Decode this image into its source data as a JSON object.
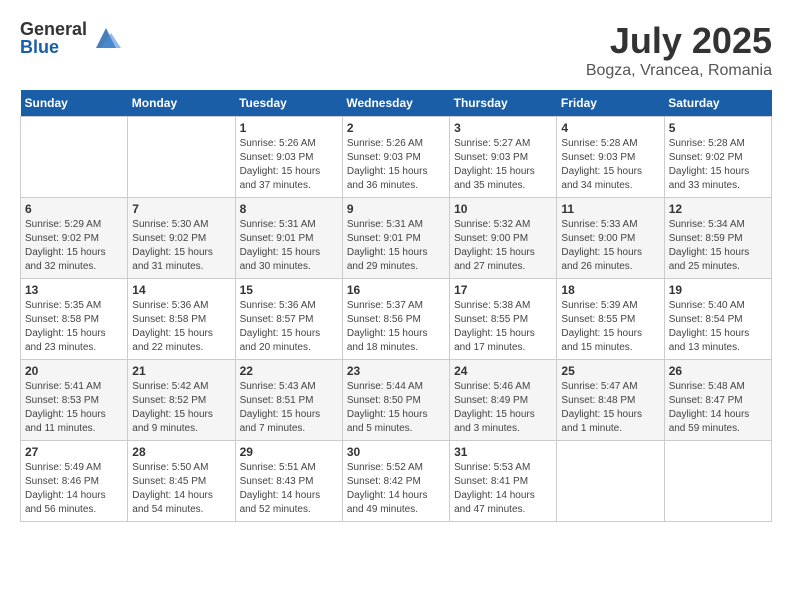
{
  "header": {
    "logo_general": "General",
    "logo_blue": "Blue",
    "month_year": "July 2025",
    "location": "Bogza, Vrancea, Romania"
  },
  "weekdays": [
    "Sunday",
    "Monday",
    "Tuesday",
    "Wednesday",
    "Thursday",
    "Friday",
    "Saturday"
  ],
  "weeks": [
    [
      {
        "day": "",
        "info": ""
      },
      {
        "day": "",
        "info": ""
      },
      {
        "day": "1",
        "info": "Sunrise: 5:26 AM\nSunset: 9:03 PM\nDaylight: 15 hours\nand 37 minutes."
      },
      {
        "day": "2",
        "info": "Sunrise: 5:26 AM\nSunset: 9:03 PM\nDaylight: 15 hours\nand 36 minutes."
      },
      {
        "day": "3",
        "info": "Sunrise: 5:27 AM\nSunset: 9:03 PM\nDaylight: 15 hours\nand 35 minutes."
      },
      {
        "day": "4",
        "info": "Sunrise: 5:28 AM\nSunset: 9:03 PM\nDaylight: 15 hours\nand 34 minutes."
      },
      {
        "day": "5",
        "info": "Sunrise: 5:28 AM\nSunset: 9:02 PM\nDaylight: 15 hours\nand 33 minutes."
      }
    ],
    [
      {
        "day": "6",
        "info": "Sunrise: 5:29 AM\nSunset: 9:02 PM\nDaylight: 15 hours\nand 32 minutes."
      },
      {
        "day": "7",
        "info": "Sunrise: 5:30 AM\nSunset: 9:02 PM\nDaylight: 15 hours\nand 31 minutes."
      },
      {
        "day": "8",
        "info": "Sunrise: 5:31 AM\nSunset: 9:01 PM\nDaylight: 15 hours\nand 30 minutes."
      },
      {
        "day": "9",
        "info": "Sunrise: 5:31 AM\nSunset: 9:01 PM\nDaylight: 15 hours\nand 29 minutes."
      },
      {
        "day": "10",
        "info": "Sunrise: 5:32 AM\nSunset: 9:00 PM\nDaylight: 15 hours\nand 27 minutes."
      },
      {
        "day": "11",
        "info": "Sunrise: 5:33 AM\nSunset: 9:00 PM\nDaylight: 15 hours\nand 26 minutes."
      },
      {
        "day": "12",
        "info": "Sunrise: 5:34 AM\nSunset: 8:59 PM\nDaylight: 15 hours\nand 25 minutes."
      }
    ],
    [
      {
        "day": "13",
        "info": "Sunrise: 5:35 AM\nSunset: 8:58 PM\nDaylight: 15 hours\nand 23 minutes."
      },
      {
        "day": "14",
        "info": "Sunrise: 5:36 AM\nSunset: 8:58 PM\nDaylight: 15 hours\nand 22 minutes."
      },
      {
        "day": "15",
        "info": "Sunrise: 5:36 AM\nSunset: 8:57 PM\nDaylight: 15 hours\nand 20 minutes."
      },
      {
        "day": "16",
        "info": "Sunrise: 5:37 AM\nSunset: 8:56 PM\nDaylight: 15 hours\nand 18 minutes."
      },
      {
        "day": "17",
        "info": "Sunrise: 5:38 AM\nSunset: 8:55 PM\nDaylight: 15 hours\nand 17 minutes."
      },
      {
        "day": "18",
        "info": "Sunrise: 5:39 AM\nSunset: 8:55 PM\nDaylight: 15 hours\nand 15 minutes."
      },
      {
        "day": "19",
        "info": "Sunrise: 5:40 AM\nSunset: 8:54 PM\nDaylight: 15 hours\nand 13 minutes."
      }
    ],
    [
      {
        "day": "20",
        "info": "Sunrise: 5:41 AM\nSunset: 8:53 PM\nDaylight: 15 hours\nand 11 minutes."
      },
      {
        "day": "21",
        "info": "Sunrise: 5:42 AM\nSunset: 8:52 PM\nDaylight: 15 hours\nand 9 minutes."
      },
      {
        "day": "22",
        "info": "Sunrise: 5:43 AM\nSunset: 8:51 PM\nDaylight: 15 hours\nand 7 minutes."
      },
      {
        "day": "23",
        "info": "Sunrise: 5:44 AM\nSunset: 8:50 PM\nDaylight: 15 hours\nand 5 minutes."
      },
      {
        "day": "24",
        "info": "Sunrise: 5:46 AM\nSunset: 8:49 PM\nDaylight: 15 hours\nand 3 minutes."
      },
      {
        "day": "25",
        "info": "Sunrise: 5:47 AM\nSunset: 8:48 PM\nDaylight: 15 hours\nand 1 minute."
      },
      {
        "day": "26",
        "info": "Sunrise: 5:48 AM\nSunset: 8:47 PM\nDaylight: 14 hours\nand 59 minutes."
      }
    ],
    [
      {
        "day": "27",
        "info": "Sunrise: 5:49 AM\nSunset: 8:46 PM\nDaylight: 14 hours\nand 56 minutes."
      },
      {
        "day": "28",
        "info": "Sunrise: 5:50 AM\nSunset: 8:45 PM\nDaylight: 14 hours\nand 54 minutes."
      },
      {
        "day": "29",
        "info": "Sunrise: 5:51 AM\nSunset: 8:43 PM\nDaylight: 14 hours\nand 52 minutes."
      },
      {
        "day": "30",
        "info": "Sunrise: 5:52 AM\nSunset: 8:42 PM\nDaylight: 14 hours\nand 49 minutes."
      },
      {
        "day": "31",
        "info": "Sunrise: 5:53 AM\nSunset: 8:41 PM\nDaylight: 14 hours\nand 47 minutes."
      },
      {
        "day": "",
        "info": ""
      },
      {
        "day": "",
        "info": ""
      }
    ]
  ]
}
